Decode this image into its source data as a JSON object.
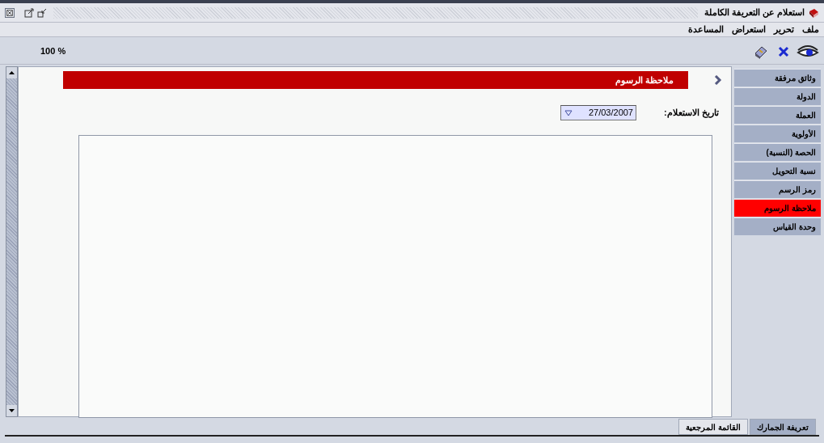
{
  "window": {
    "title": "استعلام عن التعريفة الكاملة"
  },
  "menu": [
    "ملف",
    "تحرير",
    "استعراض",
    "المساعدة"
  ],
  "toolbar": {
    "zoom": "100 %"
  },
  "panel": {
    "header": "ملاحظة الرسوم",
    "date_label": "تاريخ الاستعلام:",
    "date_value": "27/03/2007"
  },
  "sidebar": {
    "items": [
      {
        "label": "وثائق مرفقة",
        "selected": false
      },
      {
        "label": "الدولة",
        "selected": false
      },
      {
        "label": "العملة",
        "selected": false
      },
      {
        "label": "الأولوية",
        "selected": false
      },
      {
        "label": "الحصة (النسبة)",
        "selected": false
      },
      {
        "label": "نسبة التحويل",
        "selected": false
      },
      {
        "label": "رمز الرسم",
        "selected": false
      },
      {
        "label": "ملاحظة الرسوم",
        "selected": true
      },
      {
        "label": "وحدة القياس",
        "selected": false
      }
    ]
  },
  "bottom_tabs": [
    {
      "label": "تعريفة الجمارك",
      "selected": true
    },
    {
      "label": "القائمة المرجعية",
      "selected": false
    }
  ]
}
